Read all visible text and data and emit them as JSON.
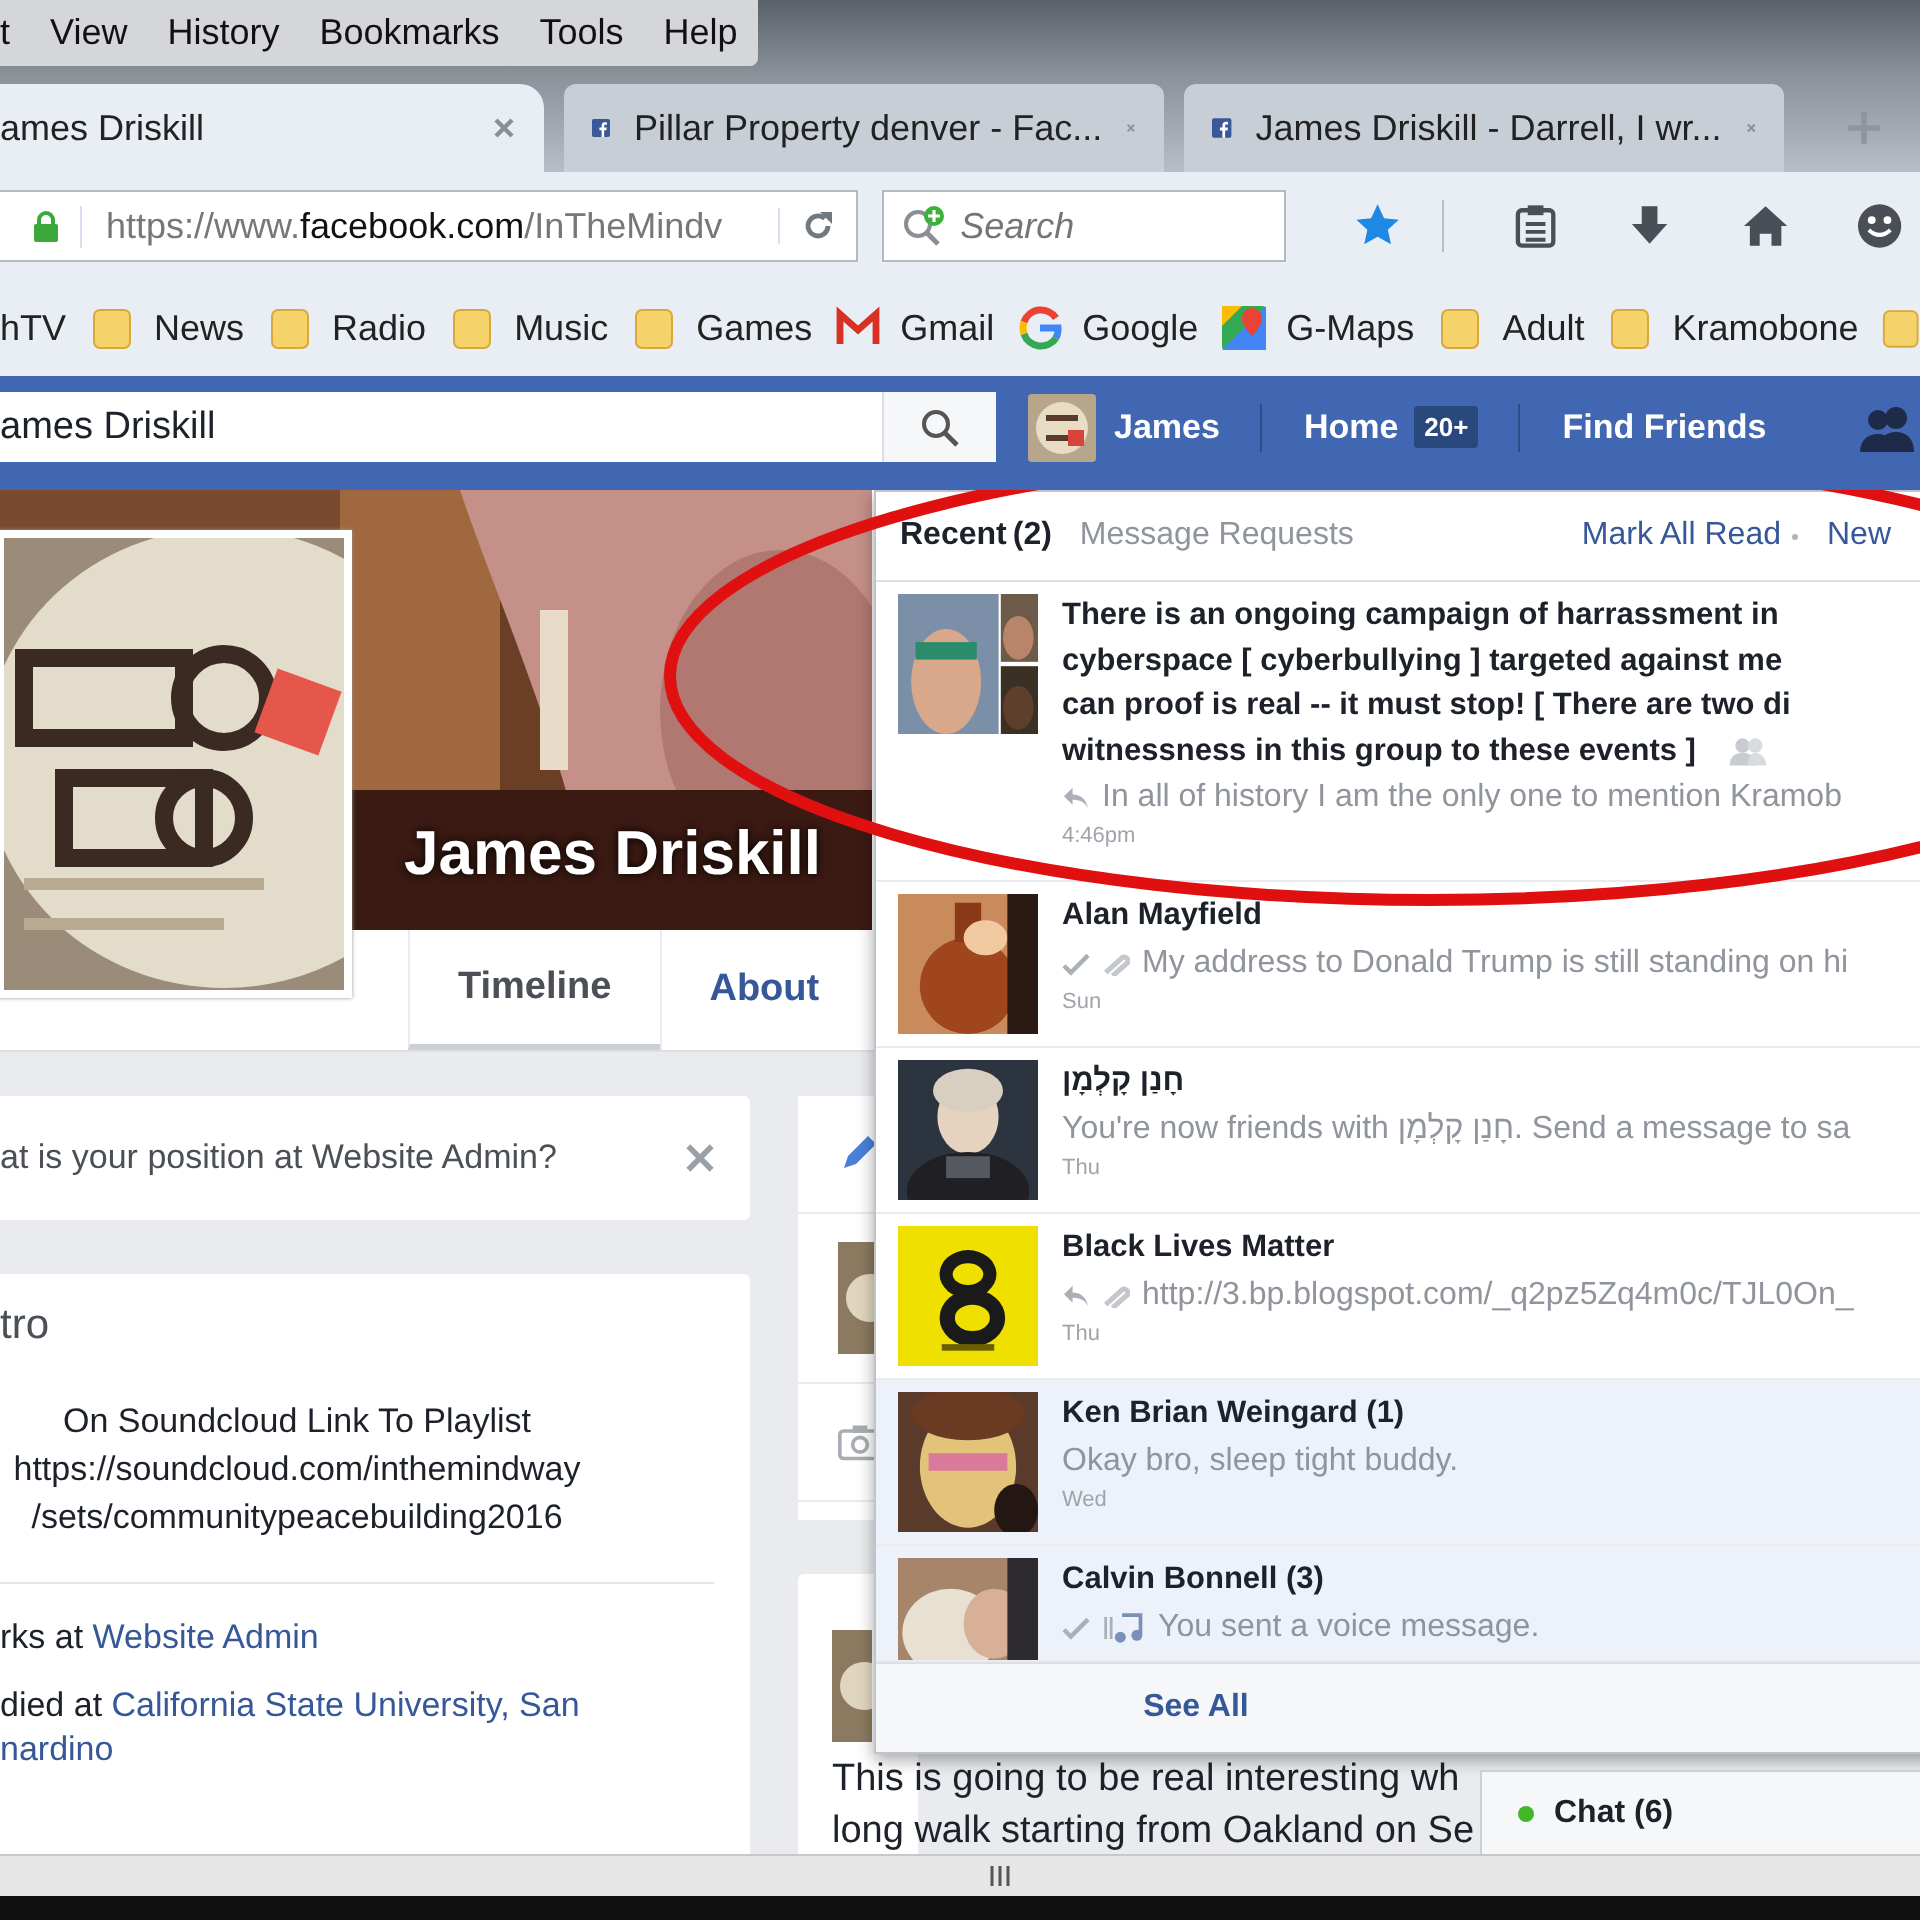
{
  "menu_bar": {
    "items": [
      "t",
      "View",
      "History",
      "Bookmarks",
      "Tools",
      "Help"
    ]
  },
  "tabs": [
    {
      "title": "ames Driskill",
      "selected": true,
      "favicon": false
    },
    {
      "title": "Pillar Property denver - Fac...",
      "selected": false,
      "favicon": true
    },
    {
      "title": "James Driskill - Darrell, I wr...",
      "selected": false,
      "favicon": true
    }
  ],
  "url_bar": {
    "prefix": "https://www.",
    "domain": "facebook.com",
    "path": "/InTheMindv"
  },
  "search": {
    "placeholder": "Search"
  },
  "bookmarks": [
    {
      "label": "hTV",
      "kind": "none"
    },
    {
      "label": "News",
      "kind": "folder"
    },
    {
      "label": "Radio",
      "kind": "folder"
    },
    {
      "label": "Music",
      "kind": "folder"
    },
    {
      "label": "Games",
      "kind": "folder"
    },
    {
      "label": "Gmail",
      "kind": "mail"
    },
    {
      "label": "Google",
      "kind": "google"
    },
    {
      "label": "G-Maps",
      "kind": "maps"
    },
    {
      "label": "Adult",
      "kind": "folder"
    },
    {
      "label": "Kramobone",
      "kind": "folder"
    }
  ],
  "fb_bar": {
    "search_value": "ames Driskill",
    "user": "James",
    "home": "Home",
    "home_badge": "20+",
    "find_friends": "Find Friends"
  },
  "profile": {
    "name": "James Driskill",
    "tabs": [
      {
        "label": "Timeline",
        "selected": true
      },
      {
        "label": "About",
        "selected": false
      }
    ]
  },
  "prompt_card": {
    "text": "at is your position at Website Admin?"
  },
  "intro": {
    "title": "tro",
    "bio": [
      "On Soundcloud Link To Playlist",
      "https://soundcloud.com/inthemindway",
      "/sets/communitypeacebuilding2016"
    ],
    "details": [
      {
        "text": "rks at ",
        "link": "Website Admin"
      },
      {
        "text": "died at ",
        "link": "California State University, San",
        "link_cont": "nardino"
      }
    ]
  },
  "post": {
    "lines": [
      "This is going to be real interesting wh",
      "long walk starting from Oakland on Se"
    ]
  },
  "messages": {
    "tabs": [
      {
        "label": "Recent",
        "count": "(2)",
        "selected": true
      },
      {
        "label": "Message Requests",
        "selected": false
      }
    ],
    "actions": [
      "Mark All Read",
      "New"
    ],
    "threads": [
      {
        "title_lines": [
          "There is an ongoing campaign of harrassment in",
          "cyberspace [ cyberbullying ] targeted against me",
          "can proof is real -- it must stop! [ There are two di",
          "witnessness in this group to these events ]"
        ],
        "group": true,
        "replied": true,
        "seen": false,
        "attachment": false,
        "voice": false,
        "snippet": "In all of history I am the only one to mention Kramob",
        "time": "4:46pm",
        "unread": false
      },
      {
        "title_lines": [
          "Alan Mayfield"
        ],
        "group": false,
        "replied": false,
        "seen": true,
        "attachment": true,
        "voice": false,
        "snippet": "My address to Donald Trump is still standing on hi",
        "time": "Sun",
        "unread": false
      },
      {
        "title_lines": [
          "חָנַן קָלְמָן"
        ],
        "group": false,
        "replied": false,
        "seen": false,
        "attachment": false,
        "voice": false,
        "snippet": "You're now friends with חָנַן קָלְמָן. Send a message to sa",
        "time": "Thu",
        "unread": false
      },
      {
        "title_lines": [
          "Black Lives Matter"
        ],
        "group": false,
        "replied": true,
        "seen": false,
        "attachment": true,
        "voice": false,
        "snippet": "http://3.bp.blogspot.com/_q2pz5Zq4m0c/TJL0On_",
        "time": "Thu",
        "unread": false
      },
      {
        "title_lines": [
          "Ken Brian Weingard (1)"
        ],
        "group": false,
        "replied": false,
        "seen": false,
        "attachment": false,
        "voice": false,
        "snippet": "Okay bro, sleep tight buddy.",
        "time": "Wed",
        "unread": true
      },
      {
        "title_lines": [
          "Calvin Bonnell (3)"
        ],
        "group": false,
        "replied": false,
        "seen": true,
        "attachment": false,
        "voice": true,
        "snippet": "You sent a voice message.",
        "unread": true
      }
    ],
    "see_all": "See All"
  },
  "chat": {
    "label": "Chat (6)",
    "online": true
  }
}
